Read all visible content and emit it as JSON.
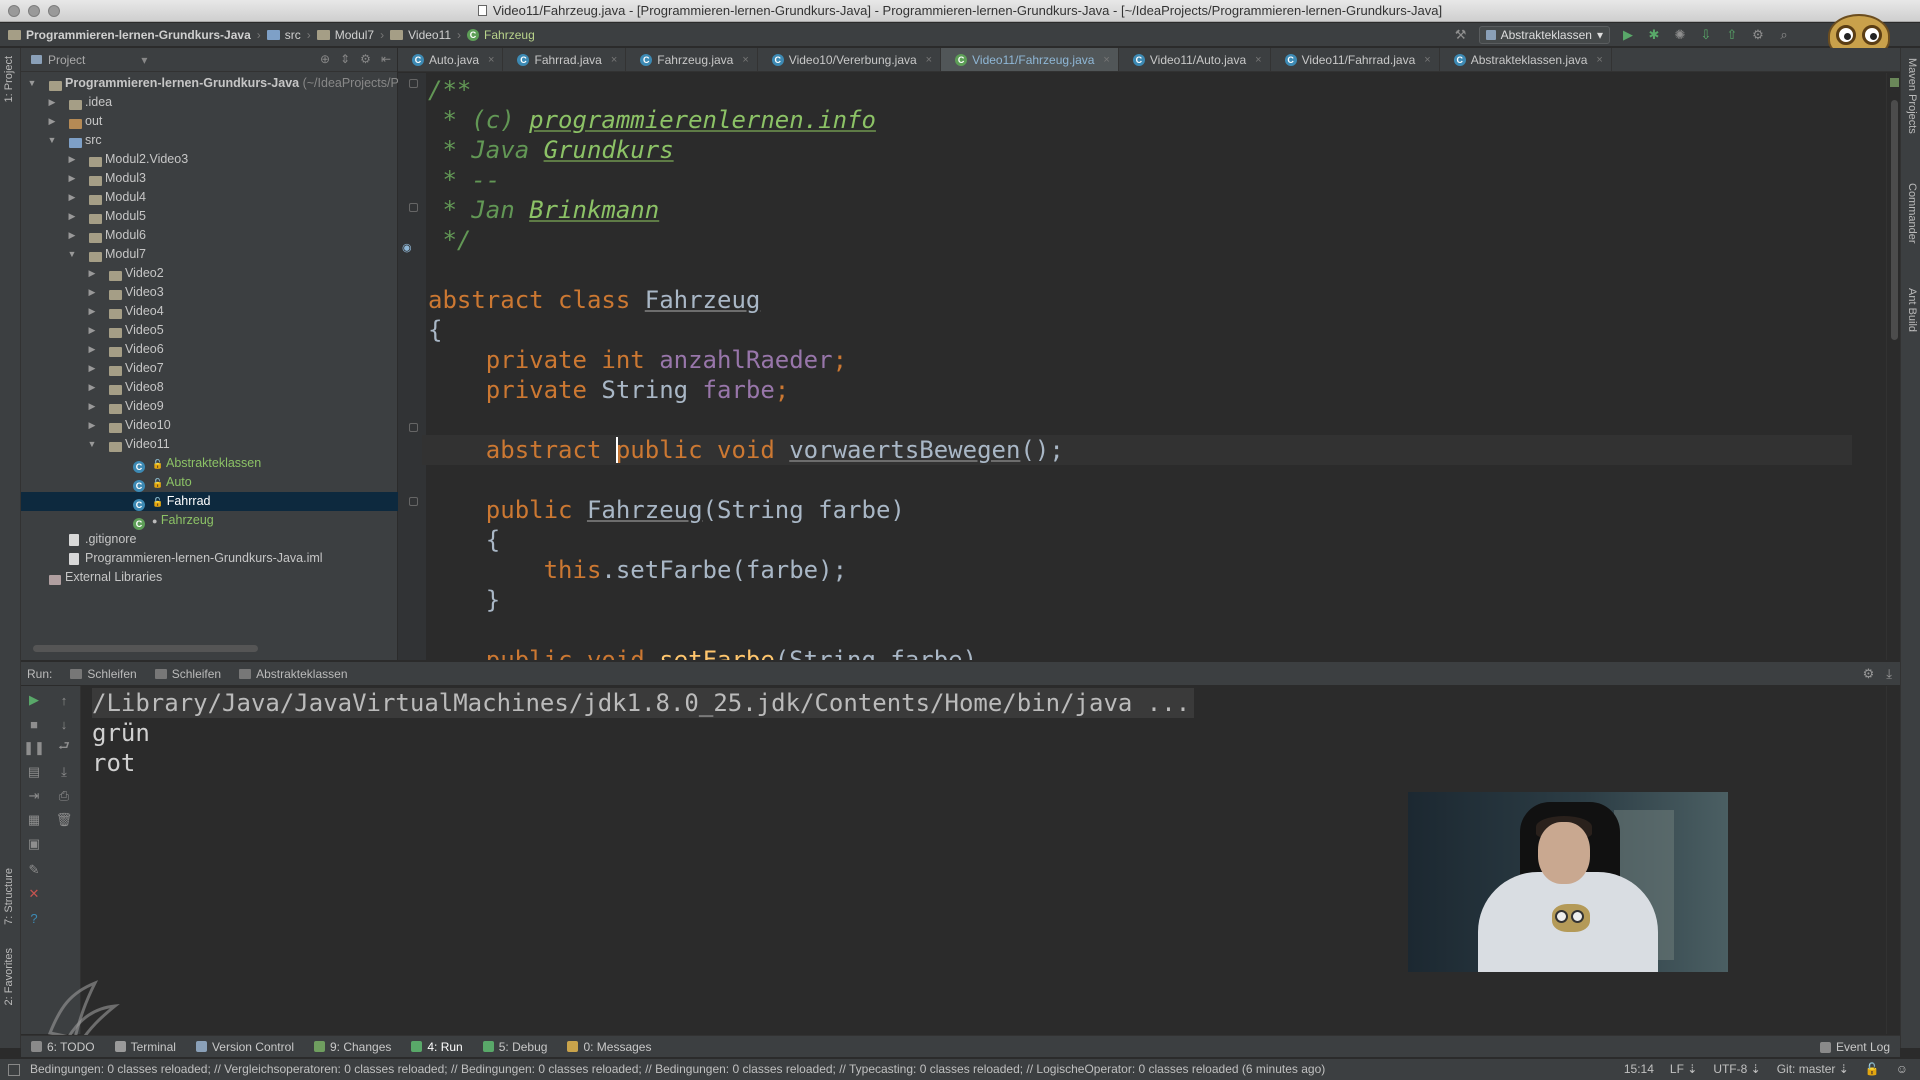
{
  "window": {
    "title": "Video11/Fahrzeug.java - [Programmieren-lernen-Grundkurs-Java] - Programmieren-lernen-Grundkurs-Java - [~/IdeaProjects/Programmieren-lernen-Grundkurs-Java]"
  },
  "breadcrumbs": [
    "Programmieren-lernen-Grundkurs-Java",
    "src",
    "Modul7",
    "Video11",
    "Fahrzeug"
  ],
  "toolbar": {
    "run_config": "Abstrakteklassen"
  },
  "left_strip": {
    "project": "1: Project",
    "structure": "7: Structure",
    "favorites": "2: Favorites"
  },
  "right_strip": {
    "maven": "Maven Projects",
    "commander": "Commander",
    "ant": "Ant Build"
  },
  "project_panel": {
    "title": "Project",
    "root": {
      "name": "Programmieren-lernen-Grundkurs-Java",
      "path": "(~/IdeaProjects/P"
    },
    "items": [
      {
        "label": "Programmieren-lernen-Grundkurs-Java",
        "type": "module"
      },
      {
        "label": ".idea",
        "type": "folder"
      },
      {
        "label": "out",
        "type": "folder"
      },
      {
        "label": "src",
        "type": "folder"
      },
      {
        "label": "Modul2.Video3",
        "type": "folder"
      },
      {
        "label": "Modul3",
        "type": "folder"
      },
      {
        "label": "Modul4",
        "type": "folder"
      },
      {
        "label": "Modul5",
        "type": "folder"
      },
      {
        "label": "Modul6",
        "type": "folder"
      },
      {
        "label": "Modul7",
        "type": "folder"
      },
      {
        "label": "Video2",
        "type": "folder"
      },
      {
        "label": "Video3",
        "type": "folder"
      },
      {
        "label": "Video4",
        "type": "folder"
      },
      {
        "label": "Video5",
        "type": "folder"
      },
      {
        "label": "Video6",
        "type": "folder"
      },
      {
        "label": "Video7",
        "type": "folder"
      },
      {
        "label": "Video8",
        "type": "folder"
      },
      {
        "label": "Video9",
        "type": "folder"
      },
      {
        "label": "Video10",
        "type": "folder"
      },
      {
        "label": "Video11",
        "type": "folder"
      },
      {
        "label": "Abstrakteklassen",
        "type": "class"
      },
      {
        "label": "Auto",
        "type": "class"
      },
      {
        "label": "Fahrrad",
        "type": "class"
      },
      {
        "label": "Fahrzeug",
        "type": "class"
      },
      {
        "label": ".gitignore",
        "type": "file"
      },
      {
        "label": "Programmieren-lernen-Grundkurs-Java.iml",
        "type": "file"
      },
      {
        "label": "External Libraries",
        "type": "library"
      }
    ]
  },
  "tabs": [
    "Auto.java",
    "Fahrrad.java",
    "Fahrzeug.java",
    "Video10/Vererbung.java",
    "Video11/Fahrzeug.java",
    "Video11/Auto.java",
    "Video11/Fahrrad.java",
    "Abstrakteklassen.java"
  ],
  "code": {
    "l1": "/**",
    "l2_prefix": " * (c) ",
    "l2_link": "programmierenlernen.info",
    "l3_prefix": " * Java ",
    "l3_word": "Grundkurs",
    "l4": " * --",
    "l5_prefix": " * Jan ",
    "l5_word": "Brinkmann",
    "l6": " */",
    "class_kw": "abstract class ",
    "class_name": "Fahrzeug",
    "brace_open": "{",
    "f1_kw": "private int ",
    "f1_name": "anzahlRaeder",
    "semi": ";",
    "f2_kw": "private ",
    "f2_type": "String ",
    "f2_name": "farbe",
    "m_abstract": "abstract ",
    "m_kw": "public void ",
    "m_name": "vorwaertsBewegen",
    "m_tail": "();",
    "ctor_kw": "public ",
    "ctor_name": "Fahrzeug",
    "ctor_tail": "(String farbe)",
    "inner_open": "{",
    "this_kw": "this",
    "this_tail": ".setFarbe(farbe);",
    "inner_close": "}",
    "last_kw": "public void ",
    "last_name": "setFarbe",
    "last_tail": "(String farbe)"
  },
  "run": {
    "label": "Run:",
    "tabs": [
      "Schleifen",
      "Schleifen",
      "Abstrakteklassen"
    ],
    "output": [
      "/Library/Java/JavaVirtualMachines/jdk1.8.0_25.jdk/Contents/Home/bin/java ...",
      "grün",
      "rot"
    ]
  },
  "tool_windows": [
    {
      "label": "6: TODO",
      "color": "#8a8a8a"
    },
    {
      "label": "Terminal",
      "color": "#9a9a9a"
    },
    {
      "label": "Version Control",
      "color": "#8aa0b8"
    },
    {
      "label": "9: Changes",
      "color": "#6f9e5f"
    },
    {
      "label": "4: Run",
      "color": "#59a869"
    },
    {
      "label": "5: Debug",
      "color": "#59a869"
    },
    {
      "label": "0: Messages",
      "color": "#c9a34b"
    }
  ],
  "event_log": "Event Log",
  "status": {
    "message": "Bedingungen: 0 classes reloaded; // Vergleichsoperatoren: 0 classes reloaded; // Bedingungen: 0 classes reloaded; // Bedingungen: 0 classes reloaded; // Typecasting: 0 classes reloaded; // LogischeOperator: 0 classes reloaded (6 minutes ago)",
    "position": "15:14",
    "line_sep": "LF ⇣",
    "encoding": "UTF-8 ⇣",
    "git": "Git: master ⇣"
  }
}
